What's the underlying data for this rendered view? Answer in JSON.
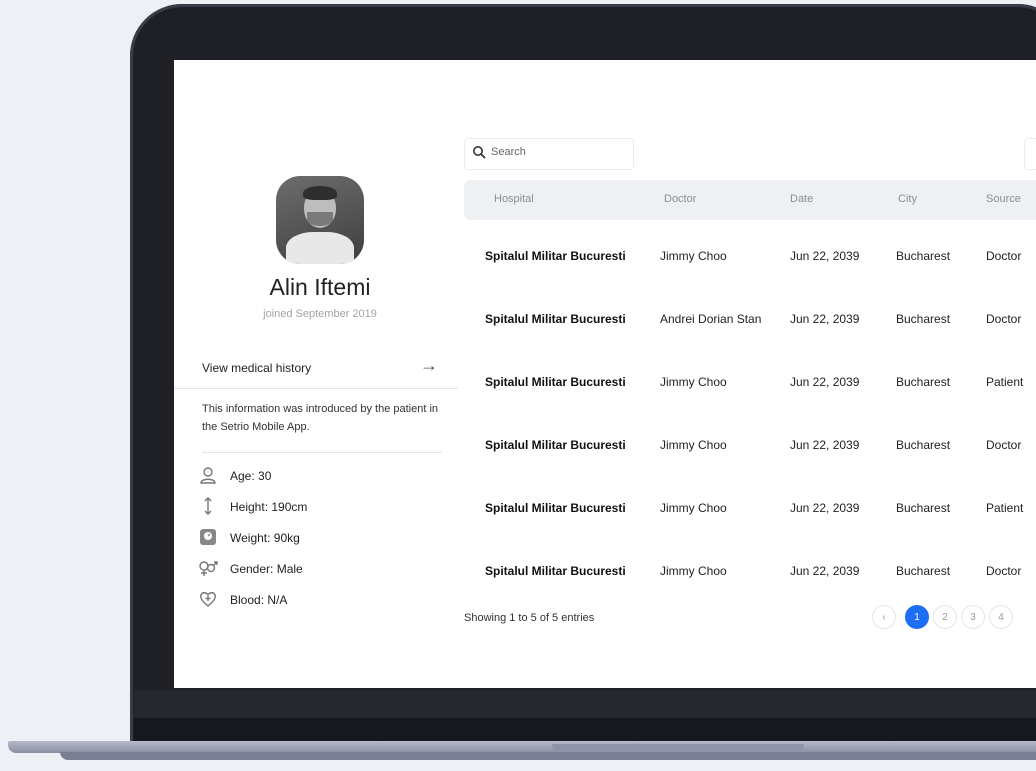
{
  "profile": {
    "name": "Alin Iftemi",
    "joined": "joined September 2019",
    "medical_history_label": "View medical history",
    "info_note": "This information was introduced by the patient in the Setrio Mobile App.",
    "details": [
      {
        "icon": "person-icon",
        "text": "Age: 30"
      },
      {
        "icon": "height-icon",
        "text": "Height: 190cm"
      },
      {
        "icon": "scale-icon",
        "text": "Weight: 90kg"
      },
      {
        "icon": "gender-icon",
        "text": "Gender: Male"
      },
      {
        "icon": "heart-plus-icon",
        "text": "Blood: N/A"
      }
    ]
  },
  "search": {
    "placeholder": "Search"
  },
  "table": {
    "columns": [
      "Hospital",
      "Doctor",
      "Date",
      "City",
      "Source"
    ],
    "rows": [
      [
        "Spitalul Militar Bucuresti",
        "Jimmy Choo",
        "Jun 22, 2039",
        "Bucharest",
        "Doctor"
      ],
      [
        "Spitalul Militar Bucuresti",
        "Andrei Dorian Stan",
        "Jun 22, 2039",
        "Bucharest",
        "Doctor"
      ],
      [
        "Spitalul Militar Bucuresti",
        "Jimmy Choo",
        "Jun 22, 2039",
        "Bucharest",
        "Patient"
      ],
      [
        "Spitalul Militar Bucuresti",
        "Jimmy Choo",
        "Jun 22, 2039",
        "Bucharest",
        "Doctor"
      ],
      [
        "Spitalul Militar Bucuresti",
        "Jimmy Choo",
        "Jun 22, 2039",
        "Bucharest",
        "Patient"
      ],
      [
        "Spitalul Militar Bucuresti",
        "Jimmy Choo",
        "Jun 22, 2039",
        "Bucharest",
        "Doctor"
      ]
    ],
    "showing": "Showing 1 to 5 of 5 entries"
  },
  "pagination": {
    "prev": "‹",
    "pages": [
      "1",
      "2",
      "3",
      "4"
    ],
    "active_page": "1"
  },
  "colors": {
    "accent": "#1e6ef5",
    "header_bg": "#eef0f4",
    "frame": "#1f2026"
  }
}
